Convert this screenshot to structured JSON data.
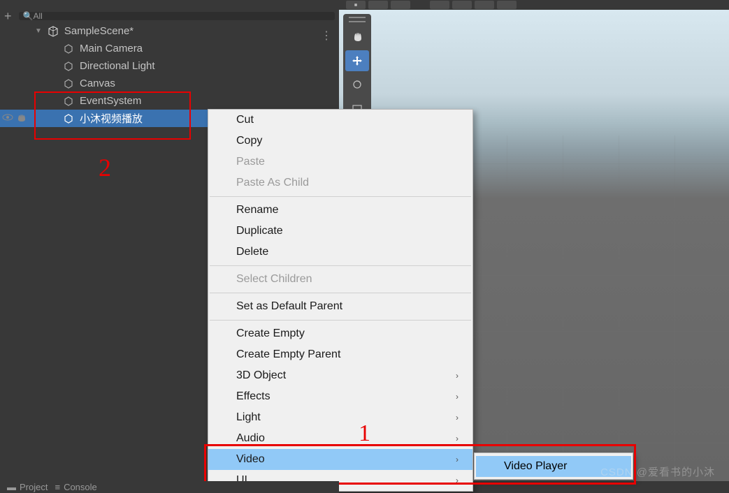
{
  "search": {
    "placeholder": "All"
  },
  "hierarchy": {
    "scene": "SampleScene*",
    "items": [
      "Main Camera",
      "Directional Light",
      "Canvas",
      "EventSystem",
      "小沐视频播放"
    ]
  },
  "contextMenu": {
    "cut": "Cut",
    "copy": "Copy",
    "paste": "Paste",
    "pasteAsChild": "Paste As Child",
    "rename": "Rename",
    "duplicate": "Duplicate",
    "delete": "Delete",
    "selectChildren": "Select Children",
    "setDefaultParent": "Set as Default Parent",
    "createEmpty": "Create Empty",
    "createEmptyParent": "Create Empty Parent",
    "object3d": "3D Object",
    "effects": "Effects",
    "light": "Light",
    "audio": "Audio",
    "video": "Video",
    "ui": "UI"
  },
  "submenu": {
    "videoPlayer": "Video Player"
  },
  "annotations": {
    "one": "1",
    "two": "2"
  },
  "tabs": {
    "project": "Project",
    "console": "Console"
  },
  "watermark": "CSDN @爱看书的小沐"
}
